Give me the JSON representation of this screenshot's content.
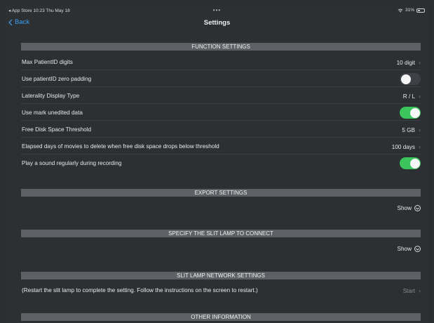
{
  "statusbar": {
    "left": "◂ App Store  10:23  Thu May 18",
    "center": "•••",
    "battery_label": "31%",
    "battery_level": 0.31
  },
  "nav": {
    "back_label": "Back",
    "title": "Settings"
  },
  "sections": {
    "function": {
      "header": "FUNCTION SETTINGS",
      "rows": [
        {
          "label": "Max PatientID digits",
          "value": "10 digit"
        },
        {
          "label": "Use patientID zero padding",
          "toggle": false
        },
        {
          "label": "Laterality Display Type",
          "value": "R / L"
        },
        {
          "label": "Use mark unedited data",
          "toggle": true
        },
        {
          "label": "Free Disk Space Threshold",
          "value": "5 GB"
        },
        {
          "label": "Elapsed days of movies to delete when free disk space drops below threshold",
          "value": "100 days"
        },
        {
          "label": "Play a sound regularly during recording",
          "toggle": true
        }
      ]
    },
    "export": {
      "header": "EXPORT SETTINGS",
      "show_label": "Show"
    },
    "slit_lamp": {
      "header": "SPECIFY THE SLIT LAMP TO CONNECT",
      "show_label": "Show"
    },
    "network": {
      "header": "SLIT LAMP NETWORK SETTINGS",
      "note": "(Restart the slit lamp to complete the setting. Follow the instructions on the screen to restart.)",
      "start_label": "Start"
    },
    "other": {
      "header": "OTHER INFORMATION"
    }
  },
  "colors": {
    "accent": "#3a9ef2",
    "toggle_on": "#3ac45b",
    "section_header_bg": "#5d6064"
  }
}
